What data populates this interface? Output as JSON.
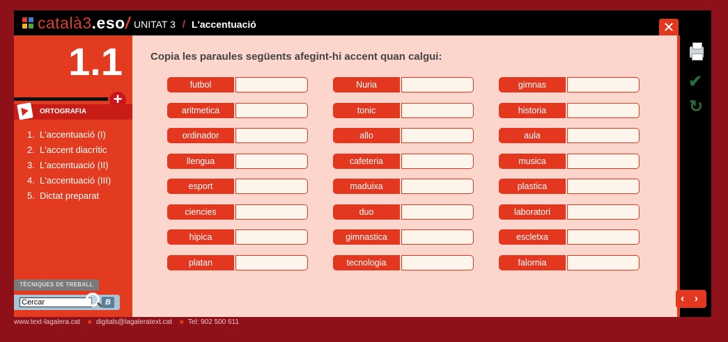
{
  "header": {
    "brand_prefix": "català3",
    "brand_eso": ".eso",
    "brand_slash": "/",
    "unit": "UNITAT 3",
    "separator": "/",
    "title": "L'accentuació",
    "close_label": "✕",
    "logo_colors": [
      "#e23a2c",
      "#3b7fd4",
      "#f0b323",
      "#57a33c"
    ]
  },
  "sidebar": {
    "section_number": "1.1",
    "plus_label": "+",
    "category": "ORTOGRAFIA",
    "items": [
      {
        "num": "1.",
        "label": "L'accentuació (I)"
      },
      {
        "num": "2.",
        "label": "L'accent diacrític"
      },
      {
        "num": "3.",
        "label": "L'accentuació (II)"
      },
      {
        "num": "4.",
        "label": "L'accentuació (III)"
      },
      {
        "num": "5.",
        "label": "Dictat preparat"
      }
    ],
    "tech_label": "TÈCNIQUES DE TREBALL",
    "search_value": "Cercar",
    "b_label": "B"
  },
  "main": {
    "instruction": "Copia les paraules següents afegint-hi accent quan calgui:",
    "columns": [
      [
        "futbol",
        "aritmetica",
        "ordinador",
        "llengua",
        "esport",
        "ciencies",
        "hipica",
        "platan"
      ],
      [
        "Nuria",
        "tonic",
        "allo",
        "cafeteria",
        "maduixa",
        "duo",
        "gimnastica",
        "tecnologia"
      ],
      [
        "gimnas",
        "historia",
        "aula",
        "musica",
        "plastica",
        "laboratori",
        "escletxa",
        "falornia"
      ]
    ]
  },
  "tools": {
    "check": "✔",
    "refresh": "↻",
    "nav_arrows": "‹ ›"
  },
  "footer": {
    "website": "www.text-lagalera.cat",
    "email": "digitals@lagaleratext.cat",
    "phone": "Tel: 902 500 611"
  }
}
